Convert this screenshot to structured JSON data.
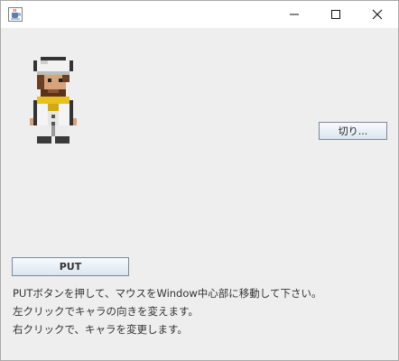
{
  "window": {
    "app_icon": "java-cup-icon",
    "controls": {
      "minimize_icon": "minimize-icon",
      "maximize_icon": "maximize-icon",
      "close_icon": "close-icon"
    }
  },
  "sprite": {
    "name": "chef-character-sprite",
    "colors": {
      "hat": "#f2f2f2",
      "skin": "#d9a27a",
      "hair": "#6b3f22",
      "beard": "#5a331a",
      "scarf": "#e8c020",
      "coat": "#f4f4f4",
      "outline": "#333333",
      "shoes": "#3a3a3a"
    }
  },
  "buttons": {
    "cut_label": "切り...",
    "put_label": "PUT"
  },
  "instructions": [
    "PUTボタンを押して、マウスをWindow中心部に移動して下さい。",
    "左クリックでキャラの向きを変えます。",
    "右クリックで、キャラを変更します。"
  ],
  "colors": {
    "window_bg": "#eeeeee",
    "titlebar_bg": "#ffffff",
    "button_border": "#7a8a99"
  }
}
